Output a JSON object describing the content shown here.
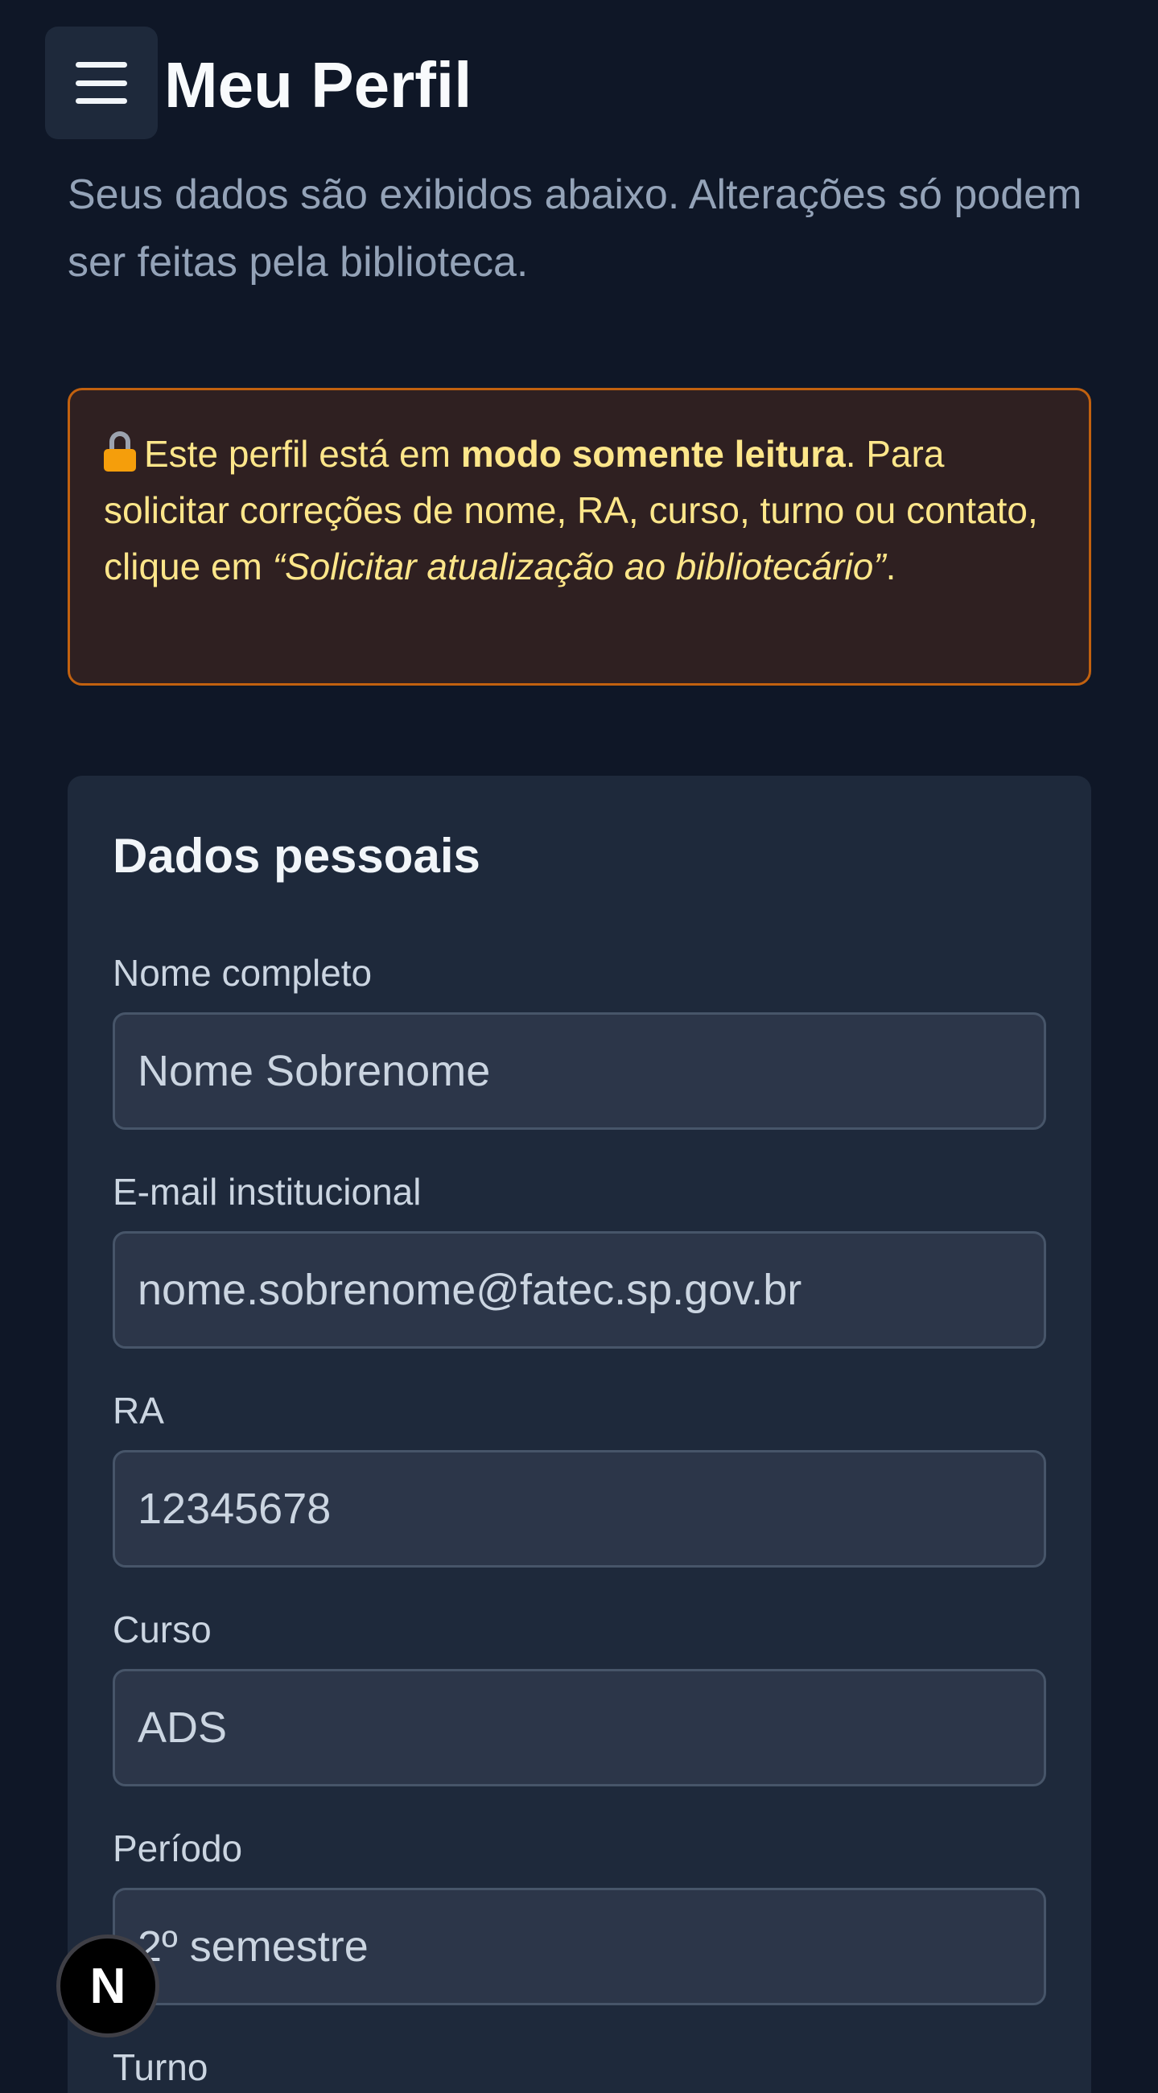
{
  "header": {
    "title": "Meu Perfil",
    "subtitle": "Seus dados são exibidos abaixo. Alterações só podem ser feitas pela biblioteca.",
    "menu_icon": "hamburger-menu-icon"
  },
  "notice": {
    "icon": "lock-icon",
    "text_before": "Este perfil está em ",
    "text_bold": "modo somente leitura",
    "text_middle": ". Para solicitar correções de nome, RA, curso, turno ou contato, clique em ",
    "text_italic": "“Solicitar atualização ao bibliotecário”",
    "text_after": ".",
    "colors": {
      "background": "#2f2021",
      "border": "#c2610f",
      "text": "#fde68a"
    }
  },
  "personal": {
    "title": "Dados pessoais",
    "fields": [
      {
        "label": "Nome completo",
        "value": "Nome Sobrenome"
      },
      {
        "label": "E-mail institucional",
        "value": "nome.sobrenome@fatec.sp.gov.br"
      },
      {
        "label": "RA",
        "value": "12345678"
      },
      {
        "label": "Curso",
        "value": "ADS"
      },
      {
        "label": "Período",
        "value": "2º semestre"
      },
      {
        "label": "Turno",
        "value": ""
      }
    ]
  },
  "dev_badge": {
    "label": "N"
  },
  "colors": {
    "page_background": "#0f1727",
    "card_background": "#1e293b",
    "input_background": "#2c3649"
  }
}
